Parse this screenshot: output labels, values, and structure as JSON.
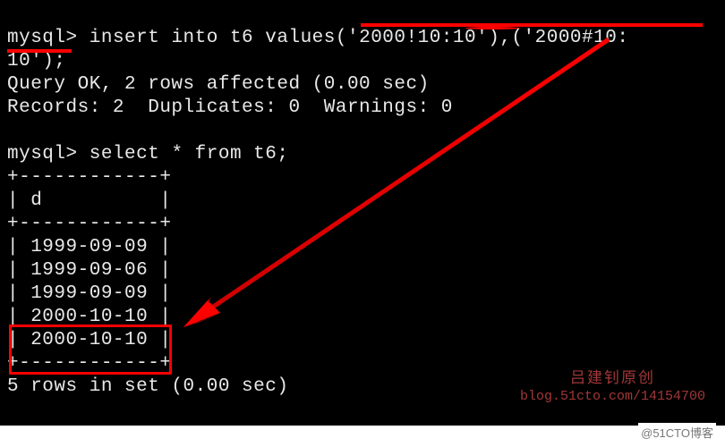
{
  "terminal": {
    "prompt": "mysql>",
    "insert_cmd_part1": "insert into t6 values",
    "insert_values": "('2000!10:10'),('2000#10:",
    "insert_cmd_part2": "10');",
    "query_ok": "Query OK, 2 rows affected (0.00 sec)",
    "records_line": "Records: 2  Duplicates: 0  Warnings: 0",
    "select_cmd": "select * from t6;",
    "table_border": "+------------+",
    "table_header": "| d          |",
    "rows": [
      "| 1999-09-09 |",
      "| 1999-09-06 |",
      "| 1999-09-09 |",
      "| 2000-10-10 |",
      "| 2000-10-10 |"
    ],
    "result_line": "5 rows in set (0.00 sec)"
  },
  "watermark": {
    "line1": "吕建钊原创",
    "line2": "blog.51cto.com/14154700"
  },
  "footer": "@51CTO博客",
  "annotations": {
    "underline1_target": "('2000!10:10'),('2000#10:",
    "underline2_target": "10');",
    "boxed_rows": [
      "2000-10-10",
      "2000-10-10"
    ],
    "arrow_from": "insert values",
    "arrow_to": "boxed rows"
  }
}
